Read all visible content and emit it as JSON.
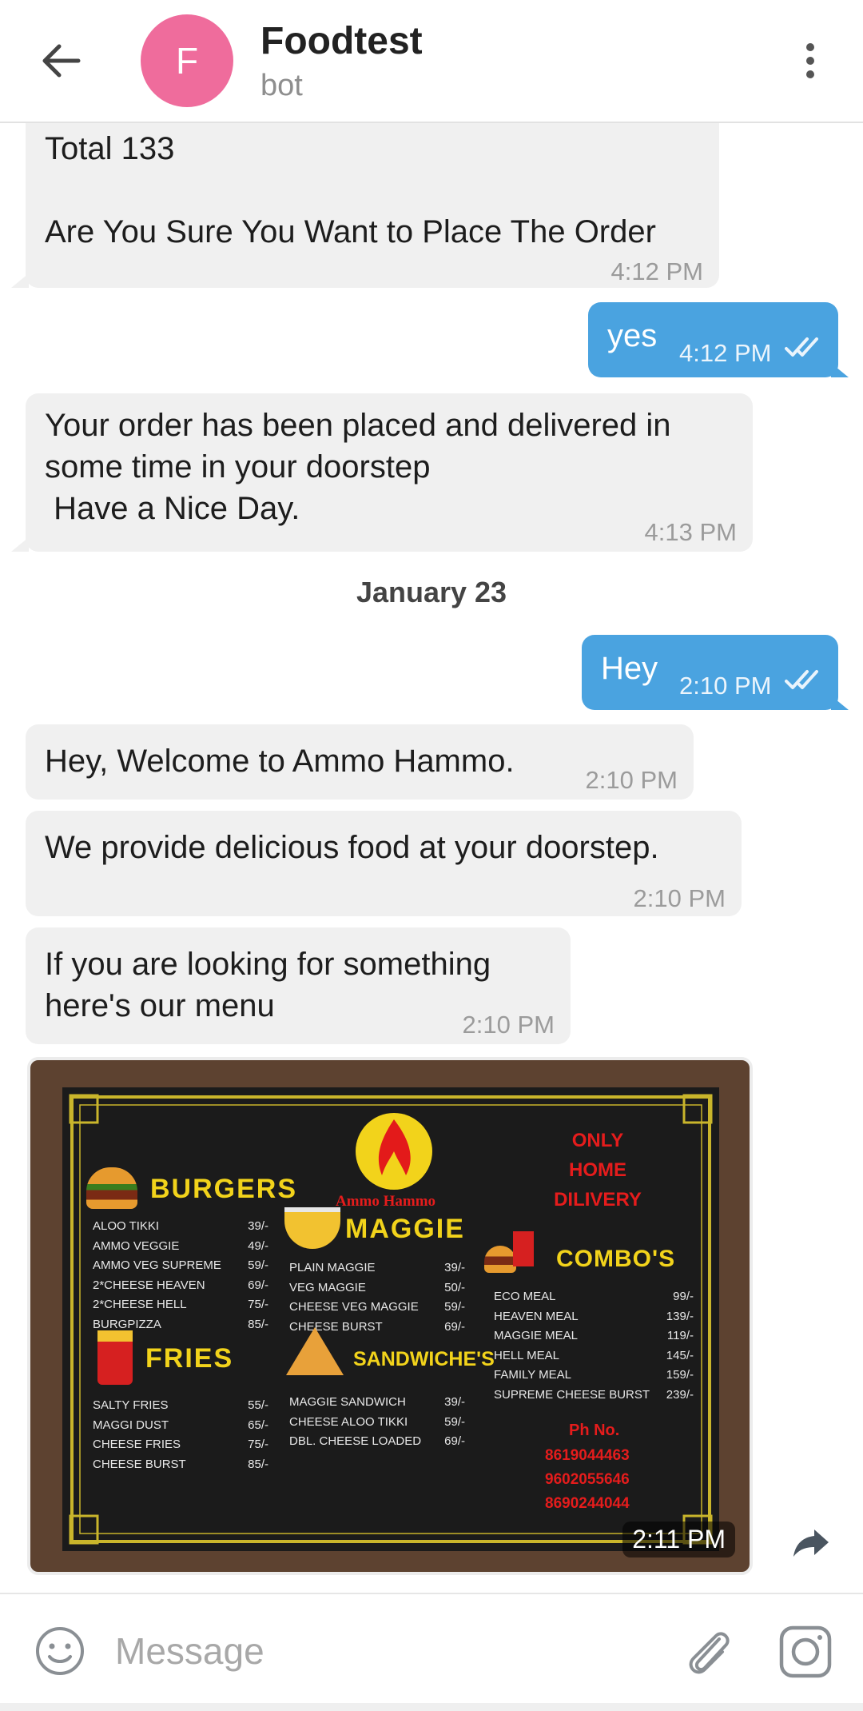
{
  "header": {
    "avatar_letter": "F",
    "title": "Foodtest",
    "subtitle": "bot"
  },
  "messages": [
    {
      "dir": "in",
      "lines": [
        "Total 133",
        "",
        "Are You Sure You Want to Place The Order"
      ],
      "time": "4:12 PM"
    },
    {
      "dir": "out",
      "text": "yes",
      "time": "4:12 PM",
      "status": "read"
    },
    {
      "dir": "in",
      "lines": [
        "Your order has been placed and delivered in",
        "some time in your doorstep",
        " Have a Nice Day."
      ],
      "time": "4:13 PM"
    },
    {
      "dir": "out",
      "text": "Hey",
      "time": "2:10 PM",
      "status": "read"
    },
    {
      "dir": "in",
      "lines": [
        "Hey, Welcome to Ammo Hammo."
      ],
      "time": "2:10 PM"
    },
    {
      "dir": "in",
      "lines": [
        "We provide delicious food at your doorstep."
      ],
      "time": "2:10 PM"
    },
    {
      "dir": "in",
      "lines": [
        "If you are looking for something",
        "here's our menu"
      ],
      "time": "2:10 PM"
    }
  ],
  "date_separator": "January 23",
  "menu_image": {
    "time": "2:11 PM",
    "brand": "Ammo Hammo",
    "brand_small": "Ammo Hammo",
    "only_home_delivery": [
      "ONLY",
      "HOME",
      "DILIVERY"
    ],
    "sections": {
      "burgers": {
        "title": "BURGERS",
        "items": [
          [
            "ALOO TIKKI",
            "39/-"
          ],
          [
            "AMMO VEGGIE",
            "49/-"
          ],
          [
            "AMMO VEG SUPREME",
            "59/-"
          ],
          [
            "2*CHEESE HEAVEN",
            "69/-"
          ],
          [
            "2*CHEESE HELL",
            "75/-"
          ],
          [
            "BURGPIZZA",
            "85/-"
          ]
        ]
      },
      "maggie": {
        "title": "MAGGIE",
        "items": [
          [
            "PLAIN MAGGIE",
            "39/-"
          ],
          [
            "VEG MAGGIE",
            "50/-"
          ],
          [
            "CHEESE VEG MAGGIE",
            "59/-"
          ],
          [
            "CHEESE BURST",
            "69/-"
          ]
        ]
      },
      "combos": {
        "title": "COMBO'S",
        "items": [
          [
            "ECO MEAL",
            "99/-"
          ],
          [
            "HEAVEN MEAL",
            "139/-"
          ],
          [
            "MAGGIE MEAL",
            "119/-"
          ],
          [
            "HELL MEAL",
            "145/-"
          ],
          [
            "FAMILY MEAL",
            "159/-"
          ],
          [
            "SUPREME CHEESE BURST",
            "239/-"
          ]
        ]
      },
      "fries": {
        "title": "FRIES",
        "items": [
          [
            "SALTY FRIES",
            "55/-"
          ],
          [
            "MAGGI  DUST",
            "65/-"
          ],
          [
            "CHEESE FRIES",
            "75/-"
          ],
          [
            "CHEESE BURST",
            "85/-"
          ]
        ]
      },
      "sandwiches": {
        "title": "SANDWICHE'S",
        "items": [
          [
            "MAGGIE SANDWICH",
            "39/-"
          ],
          [
            "CHEESE ALOO TIKKI",
            "59/-"
          ],
          [
            "DBL. CHEESE LOADED",
            "69/-"
          ]
        ]
      }
    },
    "phone_label": "Ph No.",
    "phones": [
      "8619044463",
      "9602055646",
      "8690244044"
    ]
  },
  "input": {
    "placeholder": "Message"
  },
  "icons": {
    "back": "arrow-left-icon",
    "menu": "more-vert-icon",
    "emoji": "smile-icon",
    "attach": "paperclip-icon",
    "camera": "instagram-camera-icon",
    "share": "share-arrow-icon",
    "read": "double-check-icon"
  },
  "colors": {
    "avatar": "#ef6c9c",
    "bubble_out": "#4aa3e0",
    "bubble_in": "#f0f0f0",
    "menu_yellow": "#f2d31b",
    "menu_red": "#e51c1c"
  }
}
